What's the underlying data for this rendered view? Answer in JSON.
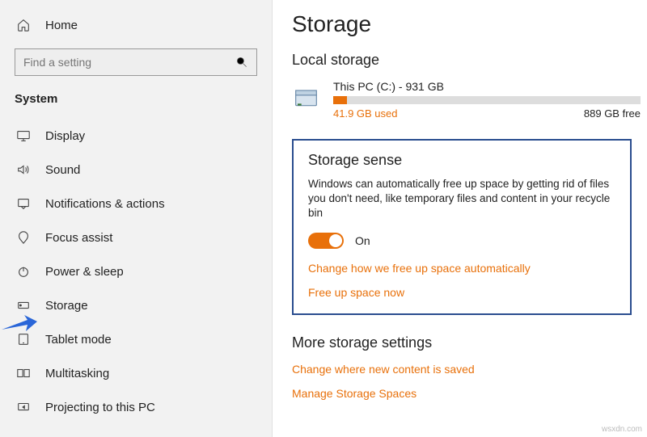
{
  "sidebar": {
    "home": "Home",
    "search_placeholder": "Find a setting",
    "section": "System",
    "items": [
      {
        "label": "Display"
      },
      {
        "label": "Sound"
      },
      {
        "label": "Notifications & actions"
      },
      {
        "label": "Focus assist"
      },
      {
        "label": "Power & sleep"
      },
      {
        "label": "Storage"
      },
      {
        "label": "Tablet mode"
      },
      {
        "label": "Multitasking"
      },
      {
        "label": "Projecting to this PC"
      }
    ]
  },
  "main": {
    "title": "Storage",
    "local_heading": "Local storage",
    "disk": {
      "name": "This PC (C:) - 931 GB",
      "used": "41.9 GB used",
      "free": "889 GB free"
    },
    "sense": {
      "heading": "Storage sense",
      "desc": "Windows can automatically free up space by getting rid of files you don't need, like temporary files and content in your recycle bin",
      "toggle_label": "On",
      "link1": "Change how we free up space automatically",
      "link2": "Free up space now"
    },
    "more": {
      "heading": "More storage settings",
      "link1": "Change where new content is saved",
      "link2": "Manage Storage Spaces"
    }
  },
  "watermark": "wsxdn.com"
}
